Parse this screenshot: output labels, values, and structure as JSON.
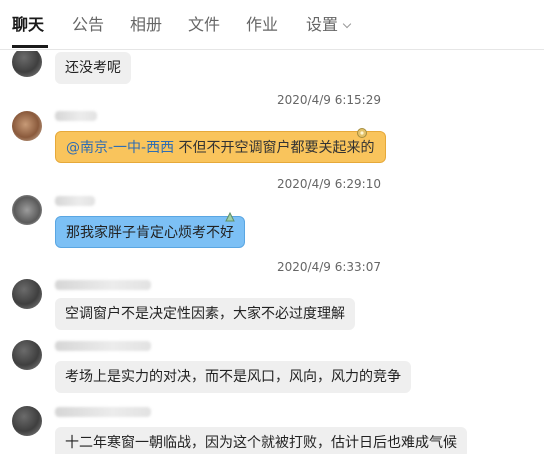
{
  "tabs": [
    {
      "label": "聊天",
      "active": true
    },
    {
      "label": "公告"
    },
    {
      "label": "相册"
    },
    {
      "label": "文件"
    },
    {
      "label": "作业"
    },
    {
      "label": "设置",
      "dropdown": true
    }
  ],
  "messages": [
    {
      "text": "还没考呢"
    },
    {
      "timestamp": "2020/4/9 6:15:29"
    },
    {
      "mention": "@南京-一中-西西",
      "text": " 不但不开空调窗户都要关起来的",
      "color": "#f9c45c"
    },
    {
      "timestamp": "2020/4/9 6:29:10"
    },
    {
      "text": "那我家胖子肯定心烦考不好",
      "color": "#7cc0f5"
    },
    {
      "timestamp": "2020/4/9 6:33:07"
    },
    {
      "text": "空调窗户不是决定性因素，大家不必过度理解"
    },
    {
      "text": "考场上是实力的对决，而不是风口，风向，风力的竞争"
    },
    {
      "text": "十二年寒窗一朝临战，因为这个就被打败，估计日后也难成气候"
    }
  ],
  "colors": {
    "accent": "#1a1a1a",
    "bubble_default": "#efefef",
    "bubble_orange": "#f9c45c",
    "bubble_blue": "#7cc0f5",
    "mention": "#2e6db3"
  }
}
